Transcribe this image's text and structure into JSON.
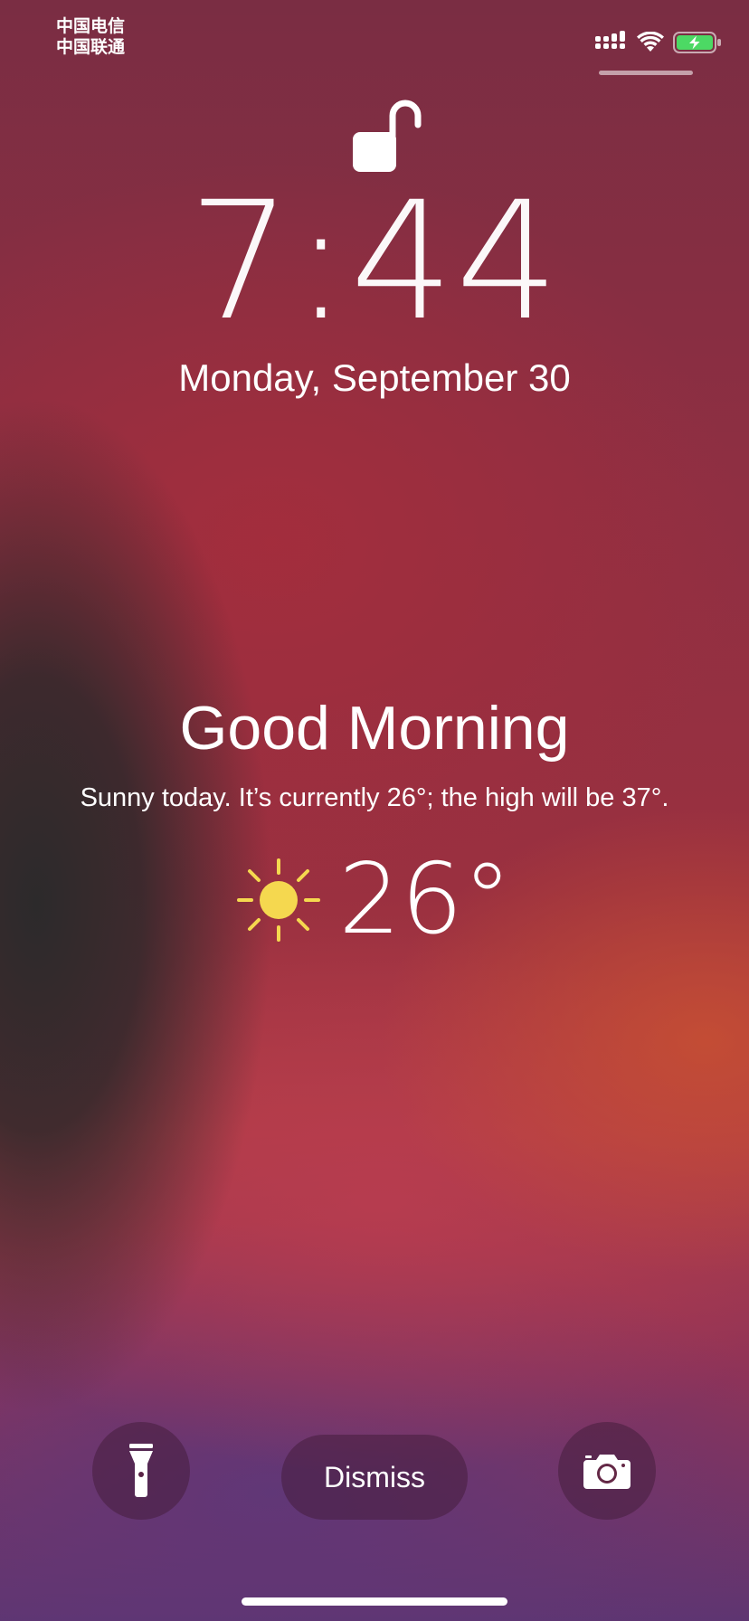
{
  "status_bar": {
    "carrier_line1": "中国电信",
    "carrier_line2": "中国联通",
    "icons": [
      "cellular-signal-icon",
      "wifi-icon",
      "battery-charging-icon"
    ],
    "battery_color": "#4cd964"
  },
  "lock": {
    "icon": "unlocked-padlock-icon",
    "time": "7:44",
    "date": "Monday, September 30"
  },
  "weather": {
    "greeting": "Good Morning",
    "summary": "Sunny today. It’s currently 26°; the high will be 37°.",
    "icon": "sun-icon",
    "sun_color": "#f5d84f",
    "temperature": "26°"
  },
  "actions": {
    "flashlight_icon": "flashlight-icon",
    "dismiss_label": "Dismiss",
    "camera_icon": "camera-icon"
  }
}
